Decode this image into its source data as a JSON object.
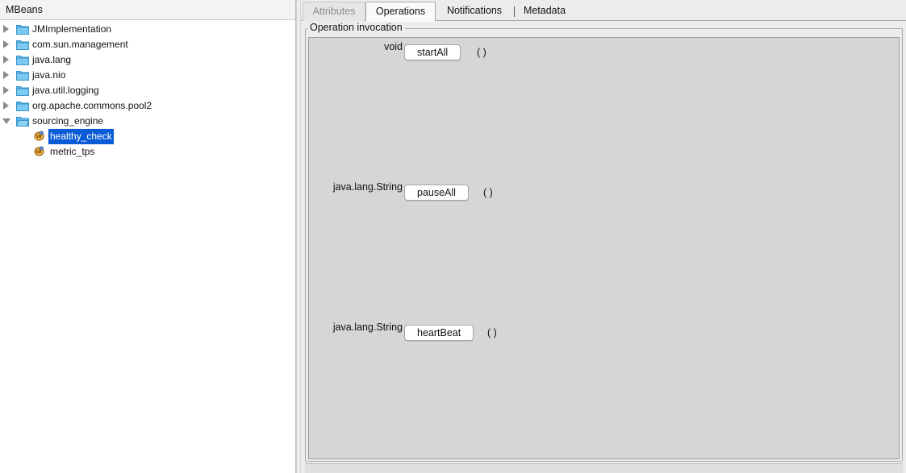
{
  "mbeans_panel": {
    "title": "MBeans",
    "tree": [
      {
        "label": "JMImplementation",
        "expanded": false
      },
      {
        "label": "com.sun.management",
        "expanded": false
      },
      {
        "label": "java.lang",
        "expanded": false
      },
      {
        "label": "java.nio",
        "expanded": false
      },
      {
        "label": "java.util.logging",
        "expanded": false
      },
      {
        "label": "org.apache.commons.pool2",
        "expanded": false
      },
      {
        "label": "sourcing_engine",
        "expanded": true,
        "children": [
          {
            "label": "healthy_check",
            "selected": true
          },
          {
            "label": "metric_tps",
            "selected": false
          }
        ]
      }
    ]
  },
  "tabs": [
    {
      "label": "Attributes",
      "state": "disabled"
    },
    {
      "label": "Operations",
      "state": "active"
    },
    {
      "label": "Notifications",
      "state": "normal"
    },
    {
      "label": "Metadata",
      "state": "normal"
    }
  ],
  "operations": {
    "legend": "Operation invocation",
    "items": [
      {
        "return_type": "void",
        "name": "startAll",
        "params": "( )"
      },
      {
        "return_type": "java.lang.String",
        "name": "pauseAll",
        "params": "( )"
      },
      {
        "return_type": "java.lang.String",
        "name": "heartBeat",
        "params": "( )"
      }
    ]
  },
  "colors": {
    "selection": "#0a5bd6",
    "folder": "#5fb7ea",
    "panel_bg": "#ececec",
    "ops_bg": "#d6d6d6"
  }
}
